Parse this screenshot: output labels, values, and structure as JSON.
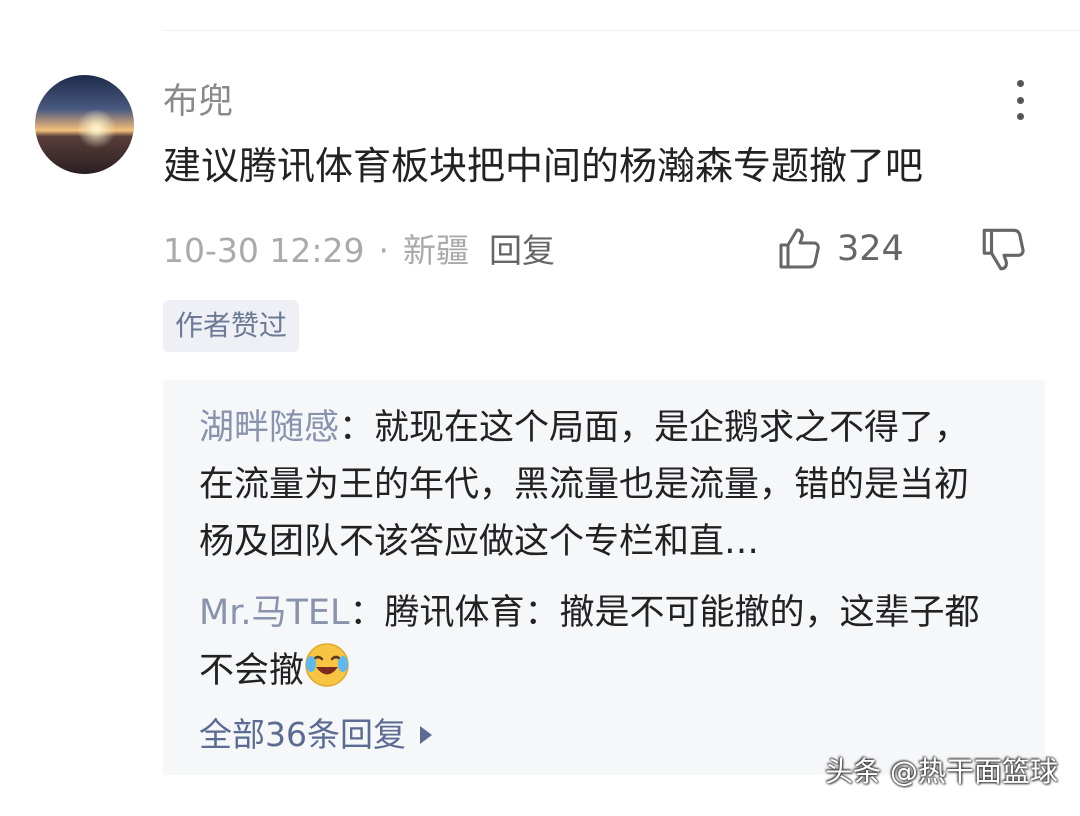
{
  "comment": {
    "username": "布兜",
    "text": "建议腾讯体育板块把中间的杨瀚森专题撤了吧",
    "timestamp": "10-30 12:29",
    "separator": "·",
    "location": "新疆",
    "reply_label": "回复",
    "like_count": "324",
    "author_badge": "作者赞过",
    "avatar_icon": "sunset-avatar-icon"
  },
  "replies": {
    "items": [
      {
        "name": "湖畔随感",
        "colon": "：",
        "text": "就现在这个局面，是企鹅求之不得了，在流量为王的年代，黑流量也是流量，错的是当初杨及团队不该答应做这个专栏和直…"
      },
      {
        "name": "Mr.马TEL",
        "colon": "：",
        "text": "腾讯体育：撤是不可能撤的，这辈子都不会撤"
      }
    ],
    "all_replies_label": "全部36条回复"
  },
  "watermark": "头条 @热干面篮球",
  "colors": {
    "name_gray": "#8a8a8a",
    "reply_name": "#8a93ad",
    "link_blue": "#5b6b94",
    "reply_bg": "#f6f7f9",
    "badge_bg": "#eef0f5"
  }
}
